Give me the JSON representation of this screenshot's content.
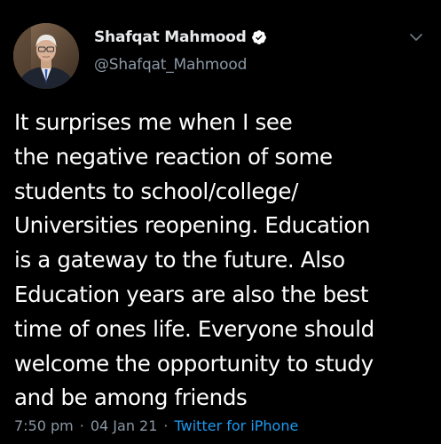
{
  "tweet": {
    "author": {
      "display_name": "Shafqat Mahmood",
      "handle": "@Shafqat_Mahmood",
      "verified": true
    },
    "text": "It surprises me when I see\nthe negative reaction of some\nstudents to school/college/\nUniversities reopening. Education\nis a gateway to the future. Also\nEducation years are also the best\ntime of ones life. Everyone should\nwelcome the opportunity to study\nand be among friends",
    "time": "7:50 pm",
    "separator": "·",
    "date": "04 Jan 21",
    "source": "Twitter for iPhone"
  },
  "colors": {
    "background": "#000000",
    "text_primary": "#ffffff",
    "text_secondary": "#8b98a5",
    "link": "#1d9bf0"
  },
  "icons": {
    "verified": "verified-badge-icon",
    "more": "chevron-down-icon"
  }
}
